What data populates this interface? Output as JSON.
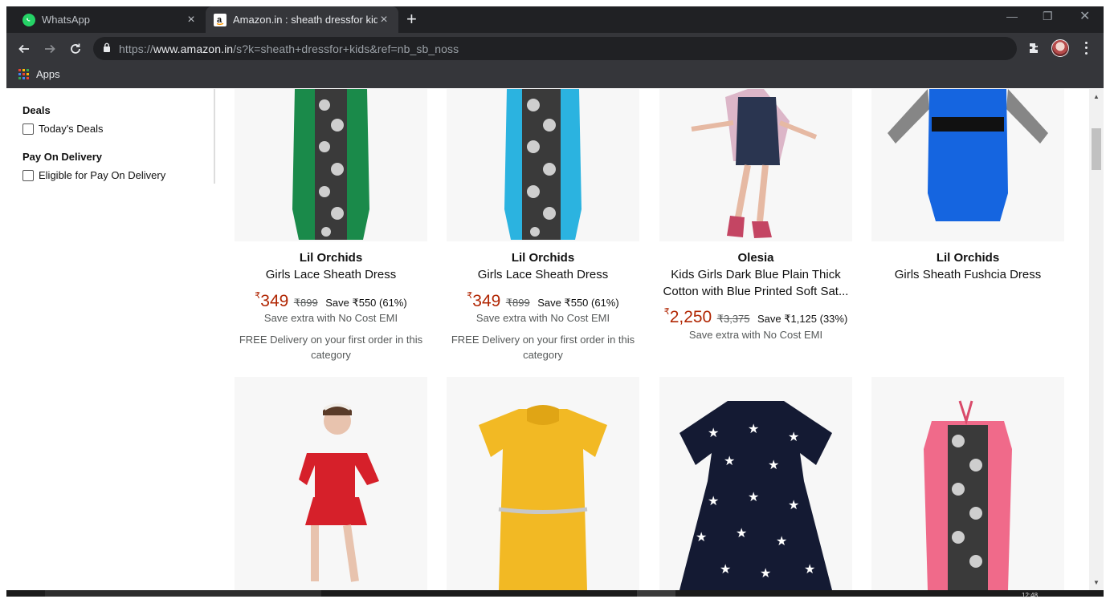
{
  "browser": {
    "tabs": [
      {
        "title": "WhatsApp",
        "favicon": "whatsapp-icon",
        "active": false
      },
      {
        "title": "Amazon.in : sheath dressfor kids",
        "favicon": "amazon-icon",
        "active": true
      }
    ],
    "url_prefix": "https://",
    "url_domain": "www.amazon.in",
    "url_path": "/s?k=sheath+dressfor+kids&ref=nb_sb_noss",
    "bookmarks": {
      "apps_label": "Apps"
    },
    "colors": {
      "frame": "#202124",
      "toolbar": "#35363a",
      "text": "#e8eaed"
    }
  },
  "sidebar": {
    "deals_heading": "Deals",
    "deals_option": "Today's Deals",
    "pod_heading": "Pay On Delivery",
    "pod_option": "Eligible for Pay On Delivery"
  },
  "products": [
    {
      "brand": "Lil Orchids",
      "name": "Girls Lace Sheath Dress",
      "currency": "₹",
      "price": "349",
      "mrp": "₹899",
      "save": "Save ₹550 (61%)",
      "emi": "Save extra with No Cost EMI",
      "delivery": "FREE Delivery on your first order in this category",
      "dress_color": "#1a8a4a"
    },
    {
      "brand": "Lil Orchids",
      "name": "Girls Lace Sheath Dress",
      "currency": "₹",
      "price": "349",
      "mrp": "₹899",
      "save": "Save ₹550 (61%)",
      "emi": "Save extra with No Cost EMI",
      "delivery": "FREE Delivery on your first order in this category",
      "dress_color": "#2bb3e0"
    },
    {
      "brand": "Olesia",
      "name": "Kids Girls Dark Blue Plain Thick Cotton with Blue Printed Soft Sat...",
      "currency": "₹",
      "price": "2,250",
      "mrp": "₹3,375",
      "save": "Save ₹1,125 (33%)",
      "emi": "Save extra with No Cost EMI",
      "dress_color": "#2a3550"
    },
    {
      "brand": "Lil Orchids",
      "name": "Girls Sheath Fushcia Dress",
      "dress_color": "#1565e0"
    }
  ],
  "second_row": [
    {
      "description": "red-peplum-dress",
      "dress_color": "#d6202a"
    },
    {
      "description": "yellow-ruffle-dress",
      "dress_color": "#f2b924"
    },
    {
      "description": "star-print-dress",
      "dress_color": "#141a33"
    },
    {
      "description": "pink-lace-dress",
      "dress_color": "#f06a8a"
    }
  ],
  "taskbar": {
    "clock": "12:48"
  }
}
